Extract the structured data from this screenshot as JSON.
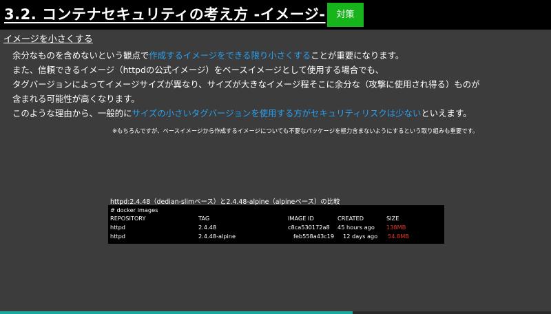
{
  "header": {
    "title": "3.2. コンテナセキュリティの考え方 -イメージ-",
    "tag_button": "対策"
  },
  "section": {
    "subheading": "イメージを小さくする",
    "lines": [
      {
        "pre": "余分なものを含めないという観点で",
        "hl": "作成するイメージをできる限り小さくする",
        "post": "ことが重要になります。"
      },
      {
        "pre": "また、信頼できるイメージ（httpdの公式イメージ）をベースイメージとして使用する場合でも、",
        "hl": "",
        "post": ""
      },
      {
        "pre": "タグバージョンによってイメージサイズが異なり、サイズが大きなイメージ程そこに余分な（攻撃に使用され得る）ものが",
        "hl": "",
        "post": ""
      },
      {
        "pre": "含まれる可能性が高くなります。",
        "hl": "",
        "post": ""
      },
      {
        "pre": "このような理由から、一般的に",
        "hl": "サイズの小さいタグバージョンを使用する方がセキュリティリスクは少ない",
        "post": "といえます。"
      }
    ],
    "note": "※もちろんですが、ベースイメージから作成するイメージについても不要なパッケージを極力含まないようにするという取り組みも重要です。"
  },
  "comparison": {
    "caption": "httpd:2.4.48（dedian-slimベース）と2.4.48-alpine（alpineベース）の比較",
    "command": "# docker images",
    "headers": {
      "repository": "REPOSITORY",
      "tag": "TAG",
      "image_id": "IMAGE ID",
      "created": "CREATED",
      "size": "SIZE"
    },
    "rows": [
      {
        "repository": "httpd",
        "tag": "2.4.48",
        "image_id": "c8ca530172a8",
        "created": "45 hours ago",
        "size": "138MB"
      },
      {
        "repository": "httpd",
        "tag": "2.4.48-alpine",
        "image_id": "feb558a43c19",
        "created": "12 days ago",
        "size": "54.8MB"
      }
    ],
    "size_color": "#e8342a"
  },
  "progress": {
    "value": 0.64,
    "color": "#1aa7a0"
  },
  "colors": {
    "background": "#3c3c3c",
    "header": "#000000",
    "accent": "#18b41c",
    "highlight": "#2aa0f0"
  }
}
